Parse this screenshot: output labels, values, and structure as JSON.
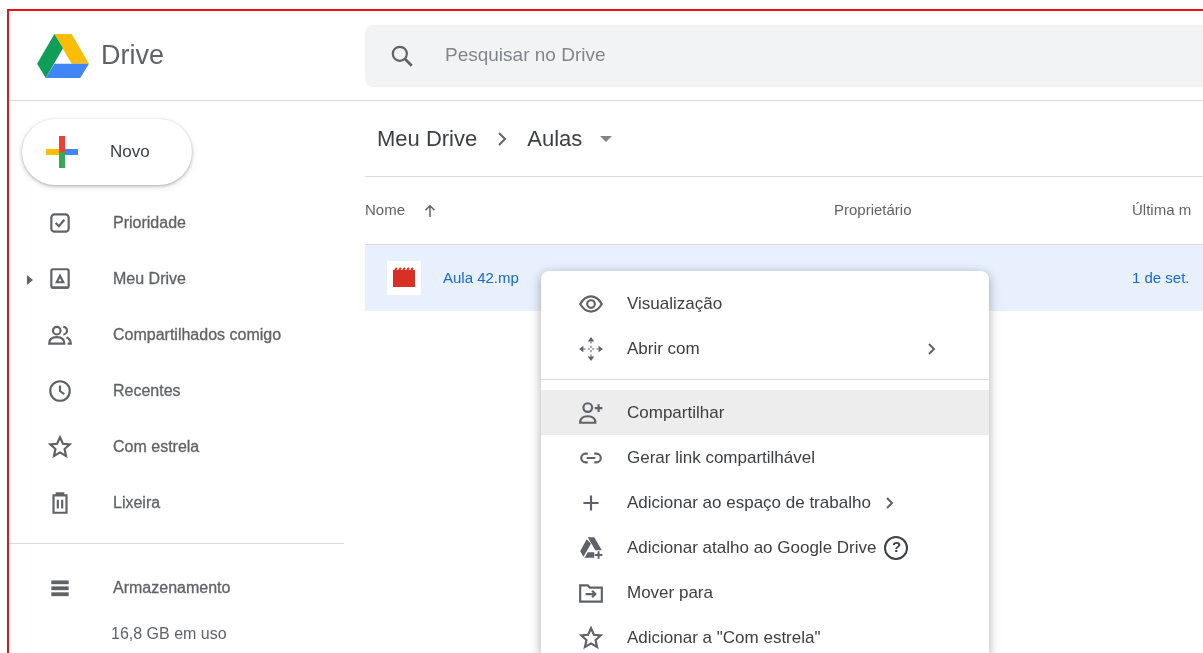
{
  "app": {
    "title": "Drive"
  },
  "search": {
    "placeholder": "Pesquisar no Drive"
  },
  "new_button": {
    "label": "Novo"
  },
  "sidebar": {
    "items": [
      {
        "label": "Prioridade",
        "selected": false
      },
      {
        "label": "Meu Drive",
        "selected": false,
        "expanded": false
      },
      {
        "label": "Compartilhados comigo",
        "selected": false
      },
      {
        "label": "Recentes",
        "selected": false
      },
      {
        "label": "Com estrela",
        "selected": false
      },
      {
        "label": "Lixeira",
        "selected": false
      }
    ],
    "storage": {
      "label": "Armazenamento",
      "usage": "16,8 GB em uso"
    }
  },
  "breadcrumb": [
    "Meu Drive",
    "Aulas"
  ],
  "table": {
    "columns": [
      "Nome",
      "Proprietário",
      "Última m"
    ],
    "rows": [
      {
        "name": "Aula 42.mp",
        "modified": "1 de set.",
        "selected": true
      }
    ]
  },
  "context_menu": {
    "groups": [
      [
        {
          "label": "Visualização",
          "submenu": false,
          "highlighted": false
        },
        {
          "label": "Abrir com",
          "submenu": true,
          "highlighted": false
        }
      ],
      [
        {
          "label": "Compartilhar",
          "submenu": false,
          "highlighted": true
        },
        {
          "label": "Gerar link compartilhável",
          "submenu": false,
          "highlighted": false
        },
        {
          "label": "Adicionar ao espaço de trabalho",
          "submenu": true,
          "highlighted": false
        },
        {
          "label": "Adicionar atalho ao Google Drive",
          "submenu": false,
          "highlighted": false,
          "help": "?"
        },
        {
          "label": "Mover para",
          "submenu": false,
          "highlighted": false
        },
        {
          "label": "Adicionar a \"Com estrela\"",
          "submenu": false,
          "highlighted": false
        }
      ]
    ]
  }
}
